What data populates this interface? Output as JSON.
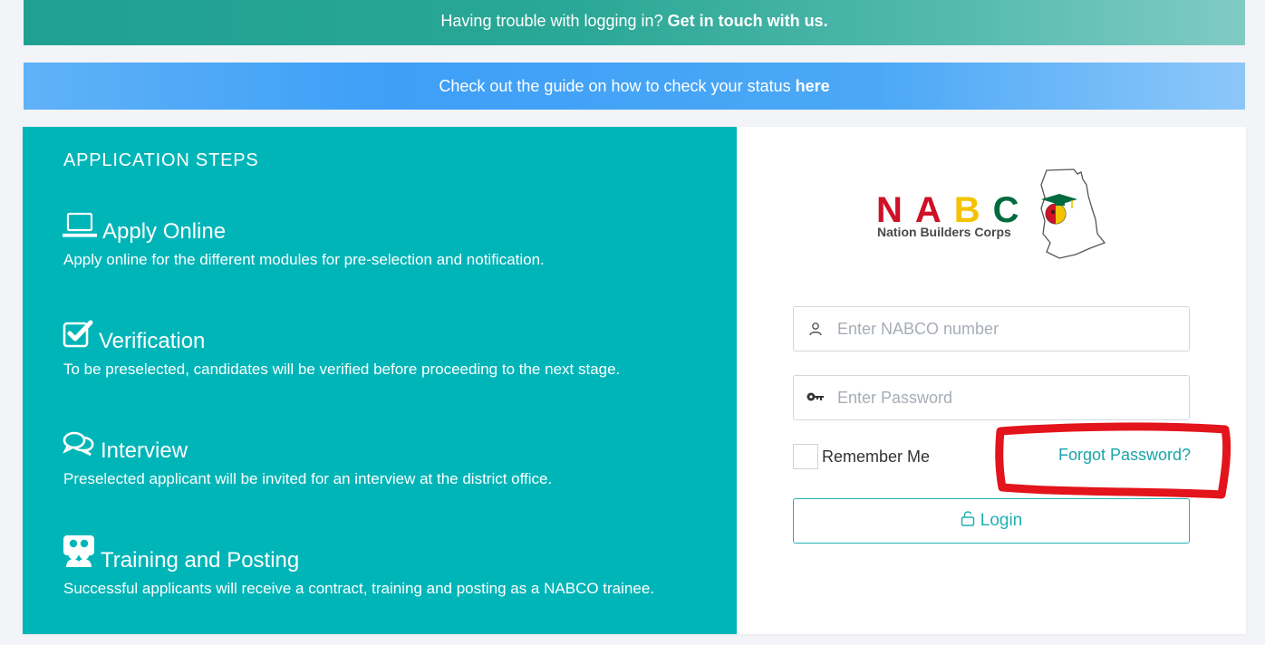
{
  "banners": {
    "trouble": {
      "text": "Having trouble with logging in? ",
      "link": "Get in touch with us."
    },
    "guide": {
      "text": "Check out the guide on how to check your status ",
      "link": "here"
    }
  },
  "steps": {
    "heading": "APPLICATION STEPS",
    "items": [
      {
        "icon": "laptop-icon",
        "title": "Apply Online",
        "description": "Apply online for the different modules for pre-selection and notification."
      },
      {
        "icon": "checkbox-icon",
        "title": "Verification",
        "description": "To be preselected, candidates will be verified before proceeding to the next stage."
      },
      {
        "icon": "chat-bubbles-icon",
        "title": "Interview",
        "description": "Preselected applicant will be invited for an interview at the district office."
      },
      {
        "icon": "people-icon",
        "title": "Training and Posting",
        "description": "Successful applicants will receive a contract, training and posting as a NABCO trainee."
      }
    ]
  },
  "logo": {
    "letters": [
      "N",
      "A",
      "B",
      "C"
    ],
    "subtitle": "Nation Builders Corps"
  },
  "form": {
    "username_placeholder": "Enter NABCO number",
    "password_placeholder": "Enter Password",
    "remember_label": "Remember Me",
    "forgot_label": "Forgot Password?",
    "login_label": "Login"
  },
  "colors": {
    "steps_panel": "#00b5b8",
    "accent": "#1fb1b4",
    "highlight": "#e3141b",
    "logo_red": "#ce1126",
    "logo_yellow": "#f4c300",
    "logo_green": "#006b3f"
  }
}
